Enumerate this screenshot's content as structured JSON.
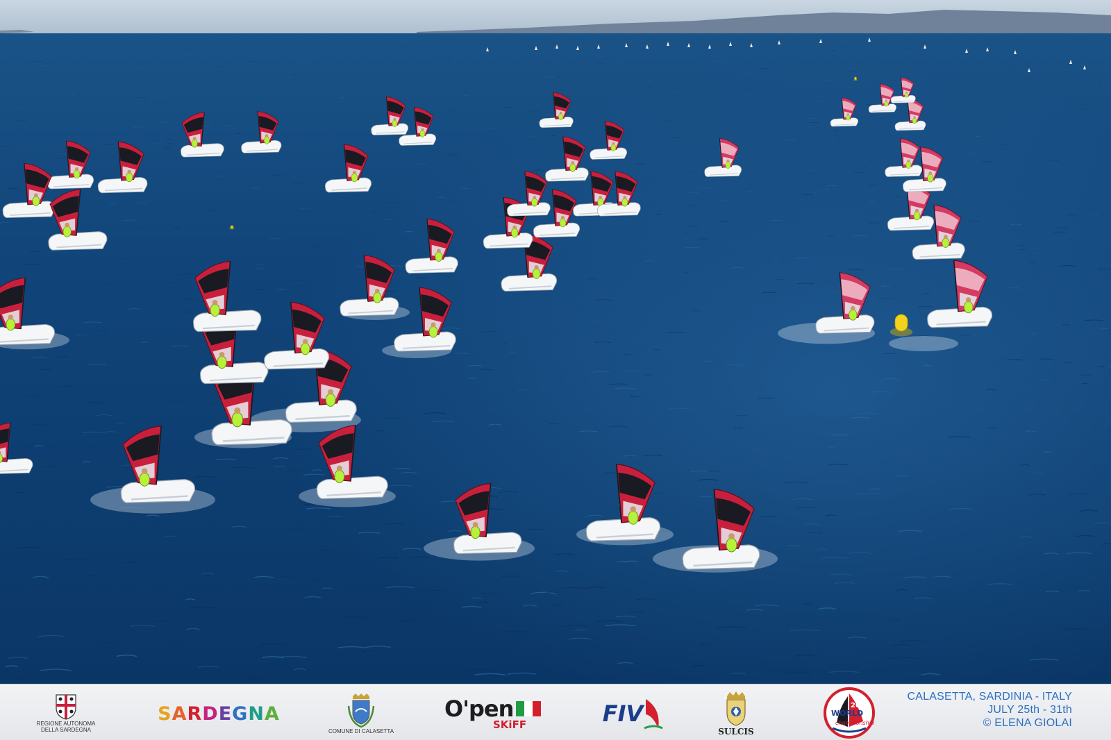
{
  "scene": {
    "description_alt": "Aerial view of a windsurfing regatta fleet on blue sea"
  },
  "sponsors": {
    "regione_line1": "REGIONE AUTONOMA",
    "regione_line2": "DELLA SARDEGNA",
    "sardegna": "SARDEGNA",
    "comune": "COMUNE DI CALASETTA",
    "open_word": "O'pen",
    "skiff_word": "SKiFF",
    "fiv": "FIV",
    "sulcis": "SULCIS",
    "world_text": "WORLD",
    "world_year": "2026",
    "world_sub": "championship"
  },
  "event": {
    "location": "CALASETTA, SARDINIA - ITALY",
    "dates": "JULY  25th - 31th",
    "credit": "© ELENA GIOLAI"
  },
  "colors": {
    "sea_deep": "#0b3a6a",
    "sea_mid": "#164f86",
    "sail_red": "#c8203c",
    "sail_dark": "#1a1a22",
    "buoy_yellow": "#f3d21a",
    "event_blue": "#2b6fc0"
  }
}
